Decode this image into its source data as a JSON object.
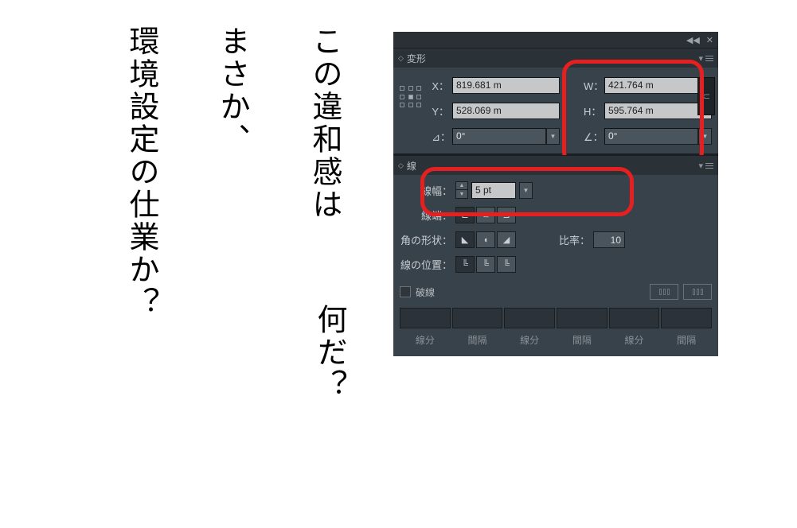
{
  "text": {
    "line1a": "この違和感は",
    "line1b": "何だ",
    "line2": "まさか、",
    "line3": "環境設定の仕業か"
  },
  "qmark": "？",
  "panel_titles": {
    "transform": "変形",
    "stroke": "線"
  },
  "transform": {
    "x_label": "X：",
    "y_label": "Y：",
    "w_label": "W：",
    "h_label": "H：",
    "rot_label": "⊿：",
    "shear_label": "∠：",
    "x": "819.681 m",
    "y": "528.069 m",
    "w": "421.764 m",
    "h": "595.764 m",
    "rot": "0°",
    "shear": "0°"
  },
  "stroke": {
    "width_label": "線幅：",
    "cap_label": "線端：",
    "join_label": "角の形状：",
    "align_label": "線の位置：",
    "ratio_label": "比率：",
    "dash_label": "破線",
    "width_value": "5 pt",
    "ratio_value": "10",
    "dash_cols": [
      "線分",
      "間隔",
      "線分",
      "間隔",
      "線分",
      "間隔"
    ]
  }
}
